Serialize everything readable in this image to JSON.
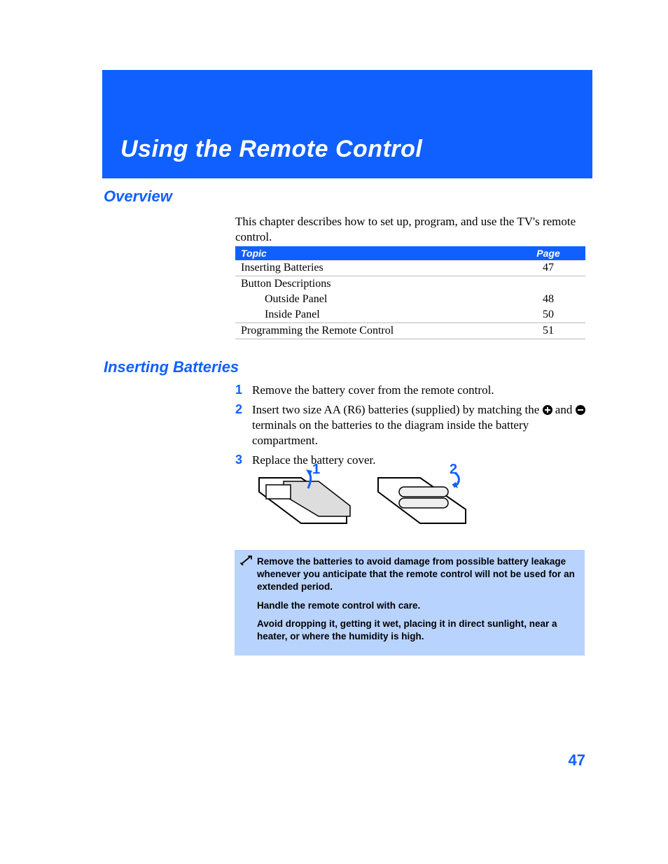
{
  "chapter_title": "Using the Remote Control",
  "page_number": "47",
  "sections": {
    "overview": {
      "heading": "Overview",
      "intro": "This chapter describes how to set up, program, and use the TV's remote control."
    },
    "inserting": {
      "heading": "Inserting Batteries"
    }
  },
  "toc": {
    "headers": {
      "topic": "Topic",
      "page": "Page"
    },
    "rows": [
      {
        "topic": "Inserting Batteries",
        "page": "47"
      },
      {
        "topic": "Button Descriptions",
        "page": ""
      },
      {
        "topic_sub": "Outside Panel",
        "page": "48"
      },
      {
        "topic_sub": "Inside Panel",
        "page": "50"
      },
      {
        "topic": "Programming the Remote Control",
        "page": "51"
      }
    ]
  },
  "steps": [
    {
      "n": "1",
      "text": "Remove the battery cover from the remote control."
    },
    {
      "n": "2",
      "text_a": "Insert two size AA (R6) batteries (supplied) by matching the ",
      "text_b": " and ",
      "text_c": " terminals on the batteries to the diagram inside the battery compartment."
    },
    {
      "n": "3",
      "text": "Replace the battery cover."
    }
  ],
  "figure_labels": {
    "one": "1",
    "two": "2"
  },
  "note": {
    "p1": "Remove the batteries to avoid damage from possible battery leakage whenever you anticipate that the remote control will not be used for an extended period.",
    "p2": "Handle the remote control with care.",
    "p3": "Avoid dropping it, getting it wet, placing it in direct sunlight, near a heater, or where the humidity is high."
  }
}
